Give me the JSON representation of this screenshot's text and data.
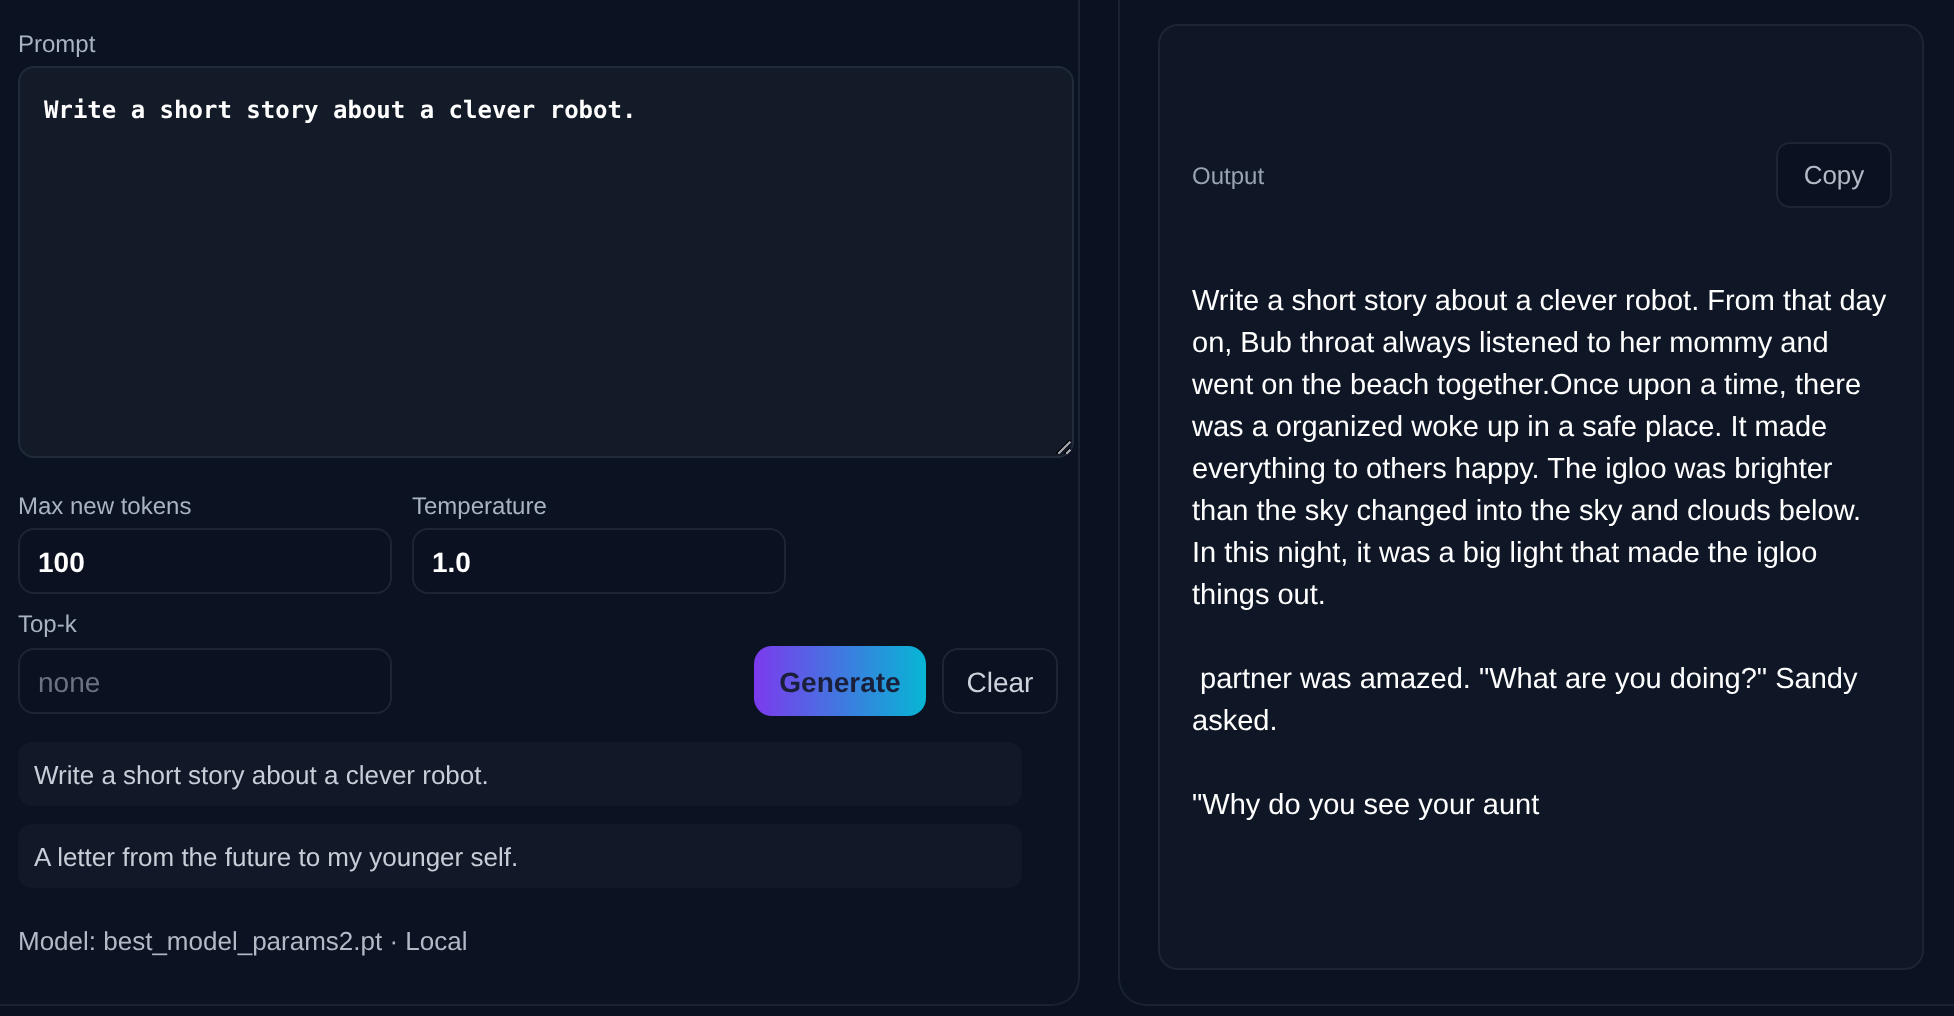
{
  "prompt": {
    "label": "Prompt",
    "value": "Write a short story about a clever robot."
  },
  "params": [
    {
      "label": "Max new tokens",
      "value": "100"
    },
    {
      "label": "Temperature",
      "value": "1.0"
    }
  ],
  "top_k": {
    "label": "Top-k",
    "placeholder": "none"
  },
  "buttons": {
    "generate": "Generate",
    "clear": "Clear"
  },
  "examples": [
    "Write a short story about a clever robot.",
    "A letter from the future to my younger self."
  ],
  "footer": "Model: best_model_params2.pt · Local",
  "output": {
    "label": "Output",
    "copy": "Copy",
    "paragraphs": [
      "Write a short story about a clever robot. From that day on, Bub throat always listened to her mommy and went on the beach together.Once upon a time, there was a organized woke up in a safe place. It made everything to others happy. The igloo was brighter than the sky changed into the sky and clouds below. In this night, it was a big light that made the igloo things out.",
      " partner was amazed. \"What are you doing?\" Sandy asked.",
      "\"Why do you see your aunt"
    ]
  }
}
